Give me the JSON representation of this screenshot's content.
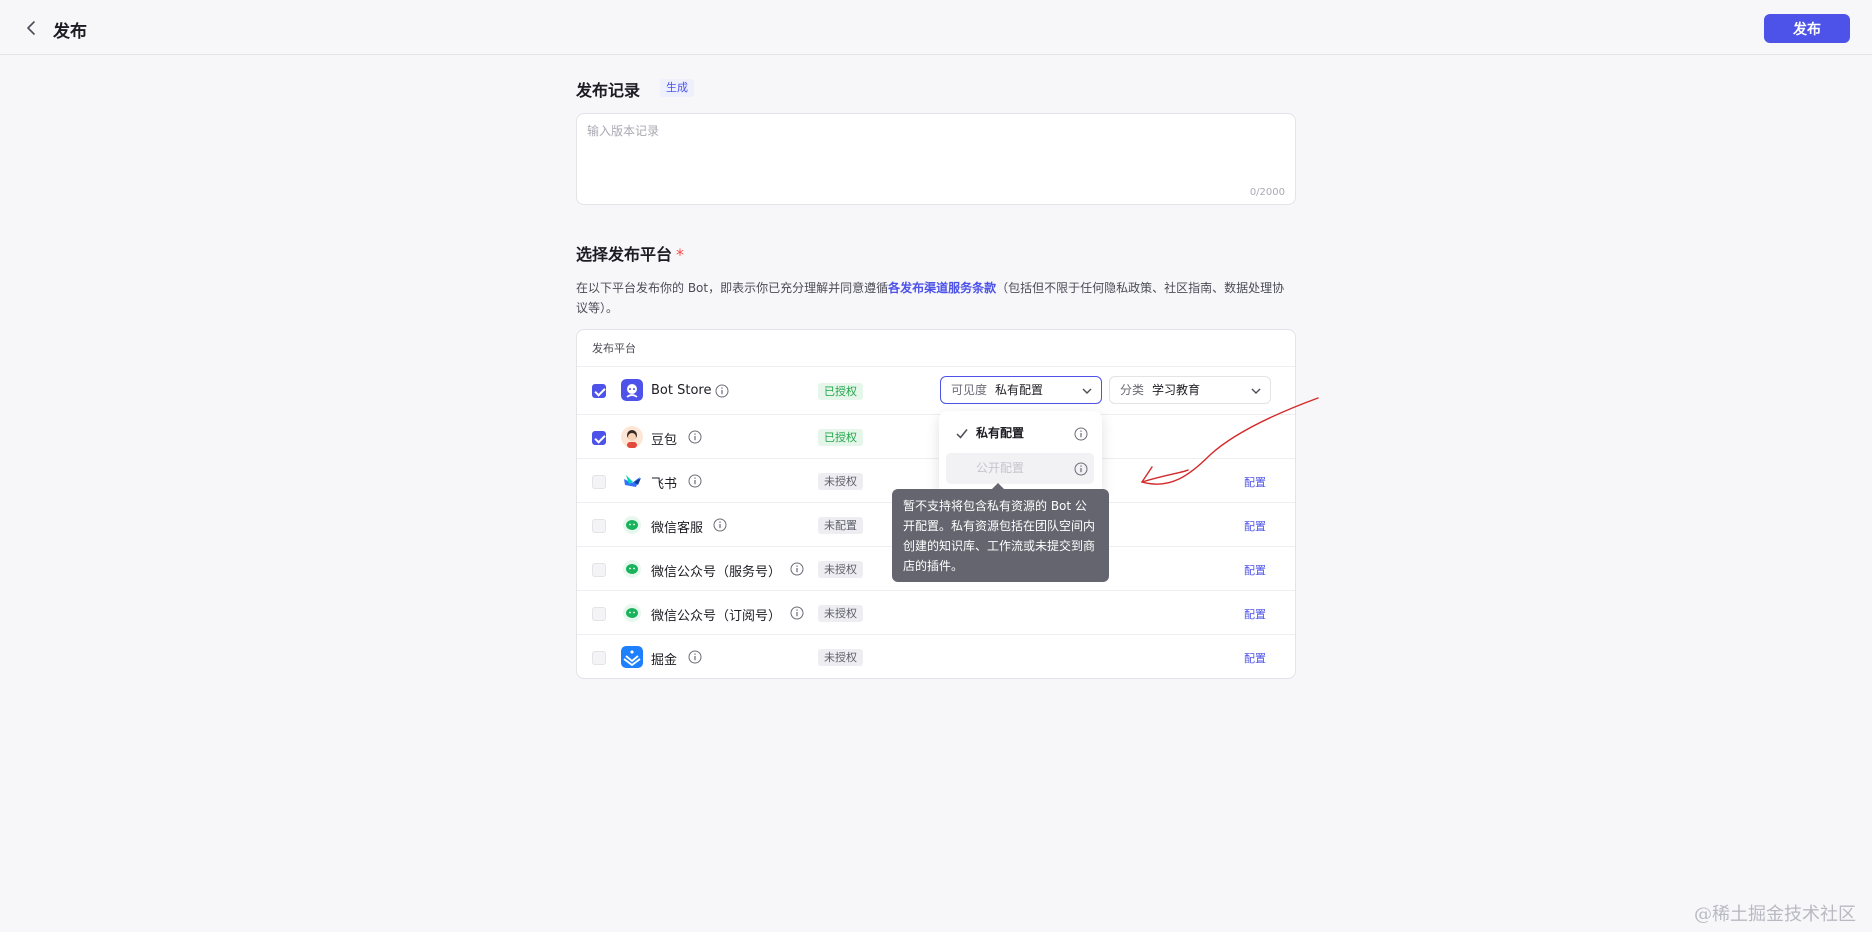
{
  "header": {
    "title": "发布",
    "publish_label": "发布"
  },
  "record": {
    "title": "发布记录",
    "generate_label": "生成",
    "placeholder": "输入版本记录",
    "char_count": "0/2000"
  },
  "platform_section": {
    "title": "选择发布平台",
    "required_mark": "*",
    "desc_before": "在以下平台发布你的 Bot，即表示你已充分理解并同意遵循",
    "desc_link": "各发布渠道服务条款",
    "desc_after": "（包括但不限于任何隐私政策、社区指南、数据处理协议等）。",
    "table_header": "发布平台",
    "rows": [
      {
        "name": "Bot Store",
        "checked": true,
        "status": "已授权",
        "status_type": "ok",
        "icon": "bot-store-icon"
      },
      {
        "name": "豆包",
        "checked": true,
        "status": "已授权",
        "status_type": "ok",
        "icon": "doubao-icon"
      },
      {
        "name": "飞书",
        "checked": false,
        "status": "未授权",
        "status_type": "no",
        "icon": "feishu-icon",
        "config": "配置"
      },
      {
        "name": "微信客服",
        "checked": false,
        "status": "未配置",
        "status_type": "no",
        "icon": "wechat-icon",
        "config": "配置"
      },
      {
        "name": "微信公众号（服务号）",
        "checked": false,
        "status": "未授权",
        "status_type": "no",
        "icon": "wechat-icon",
        "config": "配置"
      },
      {
        "name": "微信公众号（订阅号）",
        "checked": false,
        "status": "未授权",
        "status_type": "no",
        "icon": "wechat-icon",
        "config": "配置"
      },
      {
        "name": "掘金",
        "checked": false,
        "status": "未授权",
        "status_type": "no",
        "icon": "juejin-icon",
        "config": "配置"
      }
    ],
    "visibility": {
      "label": "可见度",
      "value": "私有配置"
    },
    "category": {
      "label": "分类",
      "value": "学习教育"
    }
  },
  "dropdown": {
    "options": [
      {
        "label": "私有配置",
        "selected": true,
        "disabled": false
      },
      {
        "label": "公开配置",
        "selected": false,
        "disabled": true
      }
    ]
  },
  "tooltip": {
    "text": "暂不支持将包含私有资源的 Bot 公开配置。私有资源包括在团队空间内创建的知识库、工作流或未提交到商店的插件。"
  },
  "watermark": "@稀土掘金技术社区",
  "colors": {
    "accent": "#4d53e8",
    "success": "#21a548",
    "annotation": "#d42a2a"
  }
}
